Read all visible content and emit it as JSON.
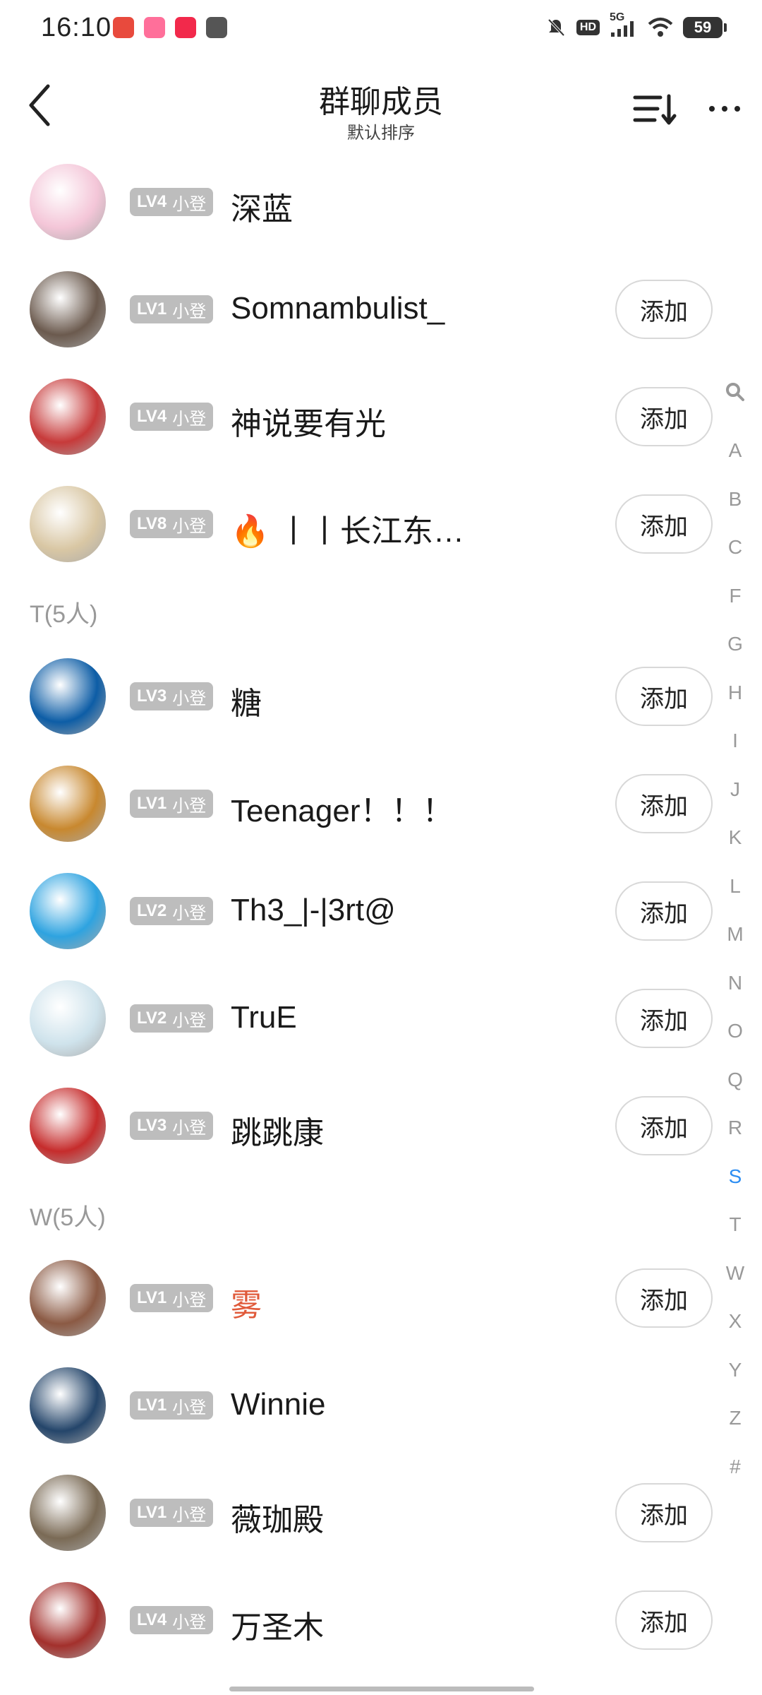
{
  "status_bar": {
    "time": "16:10",
    "notification_icons": [
      "joker-app-icon",
      "lotus-app-icon",
      "xiaohongshu-icon",
      "mail-icon"
    ],
    "network": "5G",
    "hd": "HD",
    "battery": "59"
  },
  "header": {
    "title": "群聊成员",
    "subtitle": "默认排序"
  },
  "members_top": [
    {
      "level": "LV4",
      "rank": "小登",
      "name": "深蓝",
      "add": false,
      "color": "#f4c6d8"
    },
    {
      "level": "LV1",
      "rank": "小登",
      "name": "Somnambulist_",
      "add": true,
      "color": "#6b5a4e"
    },
    {
      "level": "LV4",
      "rank": "小登",
      "name": "神说要有光",
      "add": true,
      "color": "#c73a3a"
    },
    {
      "level": "LV8",
      "rank": "小登",
      "name": "🔥 丨丨长江东…",
      "add": true,
      "color": "#d9c7a4"
    }
  ],
  "sections": [
    {
      "header": "T(5人)"
    },
    {
      "header": "W(5人)"
    }
  ],
  "members_t": [
    {
      "level": "LV3",
      "rank": "小登",
      "name": "糖",
      "add": true,
      "color": "#0d5da6"
    },
    {
      "level": "LV1",
      "rank": "小登",
      "name": "Teenager！！！",
      "add": true,
      "color": "#c8882f"
    },
    {
      "level": "LV2",
      "rank": "小登",
      "name": "Th3_|-|3rt@",
      "add": true,
      "color": "#2ea3e0"
    },
    {
      "level": "LV2",
      "rank": "小登",
      "name": "TruE",
      "add": true,
      "color": "#cfe3ec"
    },
    {
      "level": "LV3",
      "rank": "小登",
      "name": "跳跳康",
      "add": true,
      "color": "#c62c2c"
    }
  ],
  "members_w": [
    {
      "level": "LV1",
      "rank": "小登",
      "name": "雾",
      "add": true,
      "color": "#8b5a44",
      "red": true
    },
    {
      "level": "LV1",
      "rank": "小登",
      "name": "Winnie",
      "add": false,
      "color": "#24456a"
    },
    {
      "level": "LV1",
      "rank": "小登",
      "name": "薇珈殿",
      "add": true,
      "color": "#7a6a55"
    },
    {
      "level": "LV4",
      "rank": "小登",
      "name": "万圣木",
      "add": true,
      "color": "#a3302c"
    }
  ],
  "add_label": "添加",
  "index_bar": {
    "search": "search-icon",
    "letters": [
      "A",
      "B",
      "C",
      "F",
      "G",
      "H",
      "I",
      "J",
      "K",
      "L",
      "M",
      "N",
      "O",
      "Q",
      "R",
      "S",
      "T",
      "W",
      "X",
      "Y",
      "Z",
      "#"
    ],
    "active": "S",
    "active_color": "#2d8ef2"
  }
}
